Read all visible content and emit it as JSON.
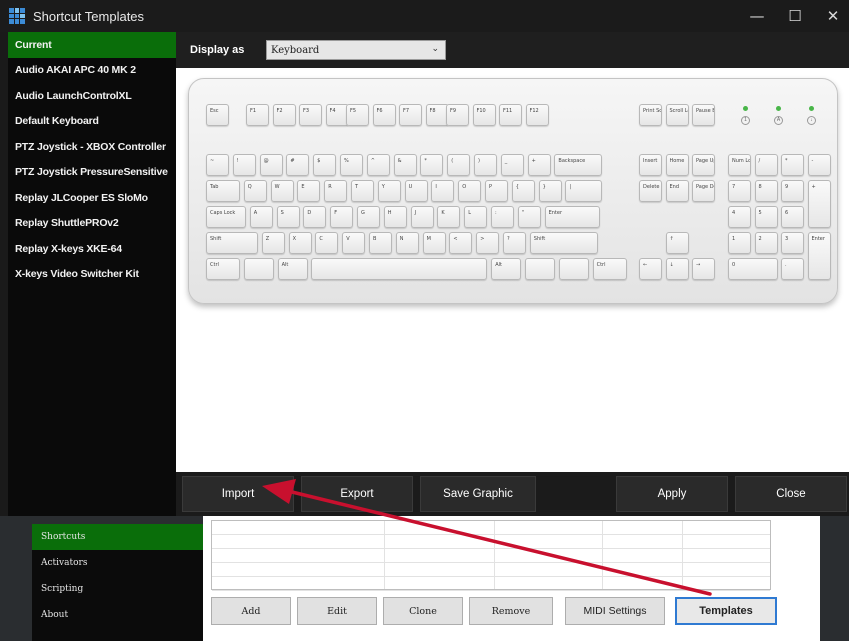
{
  "window": {
    "title": "Shortcut Templates",
    "icon": "app-grid-icon",
    "minimize": "—",
    "maximize": "☐",
    "close": "✕"
  },
  "templates": {
    "items": [
      {
        "label": "Current",
        "selected": true
      },
      {
        "label": "Audio AKAI APC 40 MK 2"
      },
      {
        "label": "Audio LaunchControlXL"
      },
      {
        "label": "Default Keyboard"
      },
      {
        "label": "PTZ Joystick - XBOX Controller"
      },
      {
        "label": "PTZ Joystick PressureSensitive"
      },
      {
        "label": "Replay JLCooper ES SloMo"
      },
      {
        "label": "Replay ShuttlePROv2"
      },
      {
        "label": "Replay X-keys XKE-64"
      },
      {
        "label": "X-keys Video Switcher Kit"
      }
    ]
  },
  "display": {
    "label": "Display as",
    "selected": "Keyboard"
  },
  "keyboard": {
    "fkeys": [
      "Esc",
      "F1",
      "F2",
      "F3",
      "F4",
      "F5",
      "F6",
      "F7",
      "F8",
      "F9",
      "F10",
      "F11",
      "F12"
    ],
    "nav_top": [
      "Print Screen",
      "Scroll Lock",
      "Pause Break"
    ],
    "row1": [
      "~",
      "!",
      "@",
      "#",
      "$",
      "%",
      "^",
      "&",
      "*",
      "(",
      ")",
      "_",
      "+",
      "Backspace"
    ],
    "row2": [
      "Tab",
      "Q",
      "W",
      "E",
      "R",
      "T",
      "Y",
      "U",
      "I",
      "O",
      "P",
      "{",
      "}",
      "|"
    ],
    "row3": [
      "Caps Lock",
      "A",
      "S",
      "D",
      "F",
      "G",
      "H",
      "J",
      "K",
      "L",
      ":",
      "\"",
      "Enter"
    ],
    "row4": [
      "Shift",
      "Z",
      "X",
      "C",
      "V",
      "B",
      "N",
      "M",
      "<",
      ">",
      "?",
      "Shift"
    ],
    "row5": [
      "Ctrl",
      "",
      "Alt",
      "",
      "Alt",
      "",
      "",
      "Ctrl"
    ],
    "nav1": [
      "Insert",
      "Home",
      "Page Up"
    ],
    "nav2": [
      "Delete",
      "End",
      "Page Down"
    ],
    "arrows": [
      "↑",
      "←",
      "↓",
      "→"
    ],
    "numpad": [
      "Num Lock",
      "/",
      "*",
      "-",
      "7",
      "8",
      "9",
      "+",
      "4",
      "5",
      "6",
      "1",
      "2",
      "3",
      "Enter",
      "0",
      "."
    ],
    "leds": [
      "1",
      "A",
      "↓"
    ]
  },
  "actions": {
    "import": "Import",
    "export": "Export",
    "save_graphic": "Save Graphic",
    "apply": "Apply",
    "close": "Close"
  },
  "nav": {
    "items": [
      {
        "label": "Shortcuts",
        "selected": true
      },
      {
        "label": "Activators"
      },
      {
        "label": "Scripting"
      },
      {
        "label": "About"
      }
    ]
  },
  "shortcut_buttons": {
    "add": "Add",
    "edit": "Edit",
    "clone": "Clone",
    "remove": "Remove",
    "midi_settings": "MIDI Settings",
    "templates": "Templates"
  },
  "colors": {
    "selected_green": "#0a6e0a",
    "annotation_red": "#c8102e",
    "active_border": "#2f7ad2"
  }
}
